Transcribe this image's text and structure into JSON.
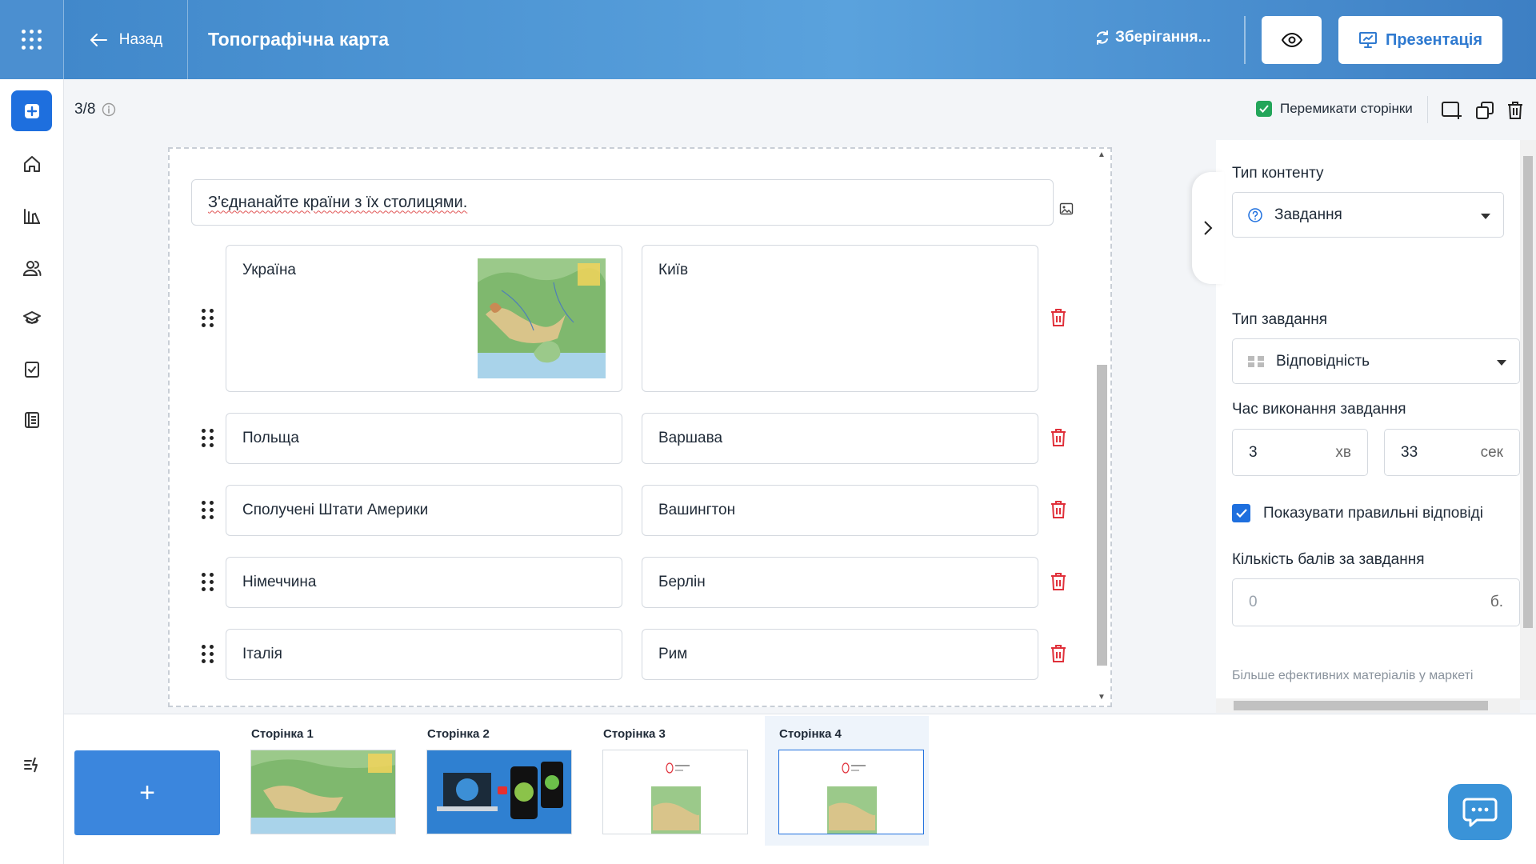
{
  "header": {
    "back_label": "Назад",
    "title": "Топографічна карта",
    "saving_label": "Зберігання...",
    "present_label": "Презентація"
  },
  "toolbar": {
    "page_counter": "3/8",
    "switch_pages_label": "Перемикати сторінки"
  },
  "task": {
    "prompt": "З'єднанайте країни з їх столицями.",
    "pairs": [
      {
        "left": "Україна",
        "right": "Київ"
      },
      {
        "left": "Польща",
        "right": "Варшава"
      },
      {
        "left": "Сполучені Штати Америки",
        "right": "Вашингтон"
      },
      {
        "left": "Німеччина",
        "right": "Берлін"
      },
      {
        "left": "Італія",
        "right": "Рим"
      }
    ]
  },
  "panel": {
    "content_type_label": "Тип контенту",
    "content_type_value": "Завдання",
    "task_type_label": "Тип завдання",
    "task_type_value": "Відповідність",
    "time_label": "Час виконання завдання",
    "minutes_value": "3",
    "minutes_unit": "хв",
    "seconds_value": "33",
    "seconds_unit": "сек",
    "show_answers_label": "Показувати правильні відповіді",
    "score_label": "Кількість балів за завдання",
    "score_placeholder": "0",
    "score_unit": "б.",
    "market_link": "Більше ефективних матеріалів у маркеті"
  },
  "pages": [
    {
      "label": "Сторінка 1"
    },
    {
      "label": "Сторінка 2"
    },
    {
      "label": "Сторінка 3"
    },
    {
      "label": "Сторінка 4"
    }
  ],
  "colors": {
    "accent": "#1e6fde",
    "danger": "#e0303a",
    "success": "#23a55a"
  }
}
